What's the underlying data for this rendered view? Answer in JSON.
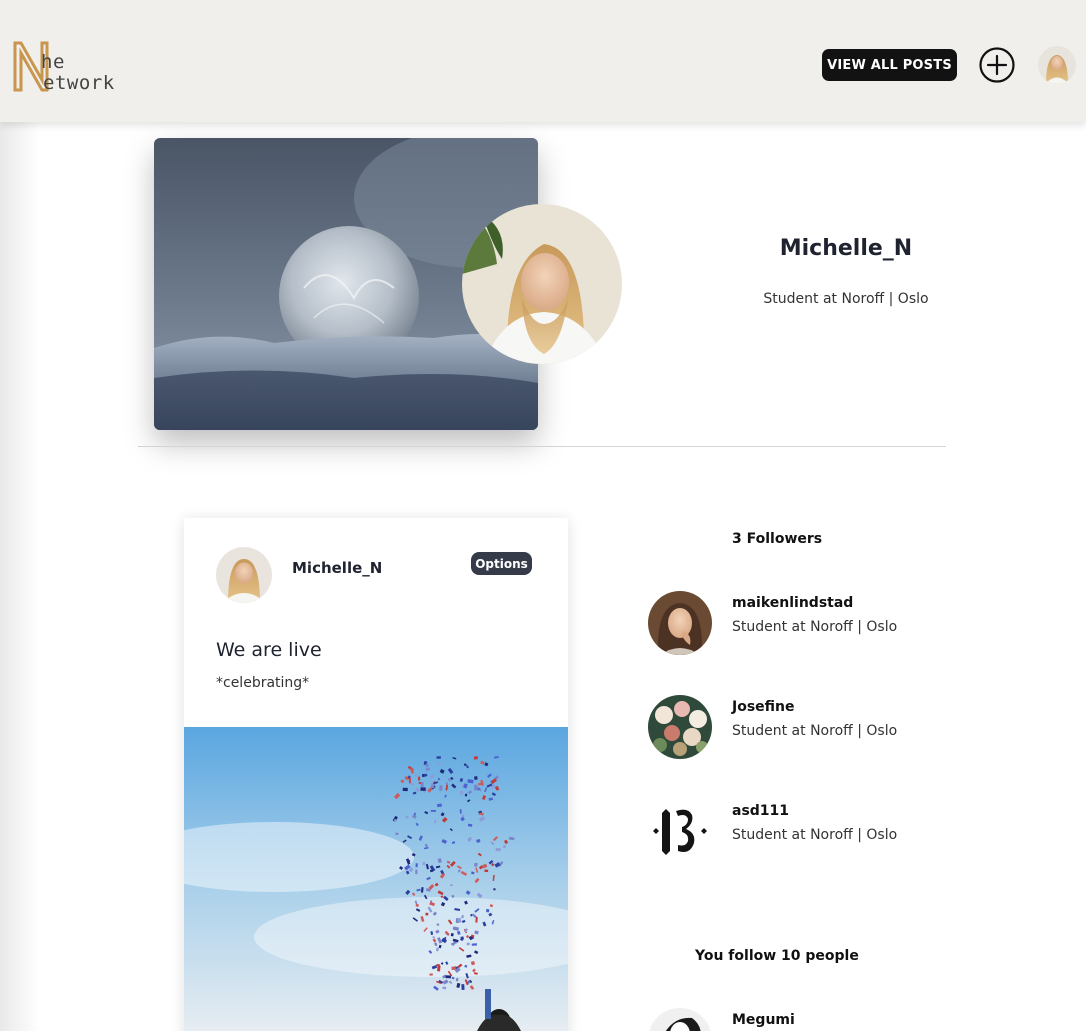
{
  "header": {
    "logo_top": "he",
    "logo_bottom": "etwork",
    "view_all_label": "VIEW ALL POSTS"
  },
  "profile": {
    "name": "Michelle_N",
    "bio": "Student at Noroff | Oslo"
  },
  "post": {
    "author": "Michelle_N",
    "options_label": "Options",
    "title": "We are live",
    "body": "*celebrating*"
  },
  "followers": {
    "heading": "3 Followers",
    "items": [
      {
        "name": "maikenlindstad",
        "bio": "Student at Noroff | Oslo"
      },
      {
        "name": "Josefine",
        "bio": "Student at Noroff | Oslo"
      },
      {
        "name": "asd111",
        "bio": "Student at Noroff | Oslo"
      }
    ]
  },
  "following": {
    "heading": "You follow 10 people",
    "items": [
      {
        "name": "Megumi"
      }
    ]
  },
  "colors": {
    "header_bg": "#f1efeb",
    "logo_gold": "#c8964e",
    "button_dark": "#121212",
    "options_bg": "#363b4a"
  },
  "icons": {
    "add": "plus-circle-icon"
  }
}
